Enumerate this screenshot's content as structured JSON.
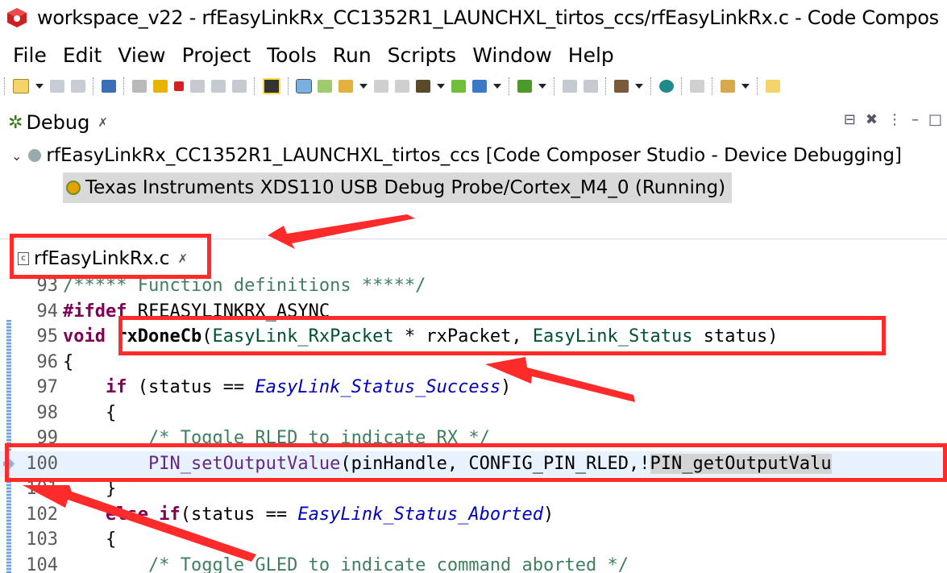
{
  "window": {
    "title": "workspace_v22 - rfEasyLinkRx_CC1352R1_LAUNCHXL_tirtos_ccs/rfEasyLinkRx.c - Code Compos"
  },
  "menu": [
    "File",
    "Edit",
    "View",
    "Project",
    "Tools",
    "Run",
    "Scripts",
    "Window",
    "Help"
  ],
  "debug_view": {
    "tab_label": "Debug",
    "close_glyph": "✗",
    "project_node": "rfEasyLinkRx_CC1352R1_LAUNCHXL_tirtos_ccs [Code Composer Studio - Device Debugging]",
    "probe_node": "Texas Instruments XDS110 USB Debug Probe/Cortex_M4_0 (Running)"
  },
  "editor": {
    "tab_label": "rfEasyLinkRx.c",
    "close_glyph": "✗",
    "lines": [
      {
        "n": "93",
        "parts": [
          [
            "cm",
            "/***** Function definitions *****/"
          ]
        ]
      },
      {
        "n": "94",
        "parts": [
          [
            "kw",
            "#ifdef"
          ],
          [
            "",
            " RFEASYLINKRX_ASYNC"
          ]
        ]
      },
      {
        "n": "95",
        "parts": [
          [
            "kw",
            "void"
          ],
          [
            "",
            " "
          ],
          [
            "fn",
            "rxDoneCb"
          ],
          [
            "",
            "("
          ],
          [
            "ty",
            "EasyLink_RxPacket"
          ],
          [
            "",
            " * rxPacket, "
          ],
          [
            "ty",
            "EasyLink_Status"
          ],
          [
            "",
            " status)"
          ]
        ]
      },
      {
        "n": "96",
        "parts": [
          [
            "",
            "{"
          ]
        ]
      },
      {
        "n": "97",
        "parts": [
          [
            "",
            "    "
          ],
          [
            "kw",
            "if"
          ],
          [
            "",
            " (status == "
          ],
          [
            "it",
            "EasyLink_Status_Success"
          ],
          [
            "",
            ")"
          ]
        ]
      },
      {
        "n": "98",
        "parts": [
          [
            "",
            "    {"
          ]
        ]
      },
      {
        "n": "99",
        "parts": [
          [
            "",
            "        "
          ],
          [
            "cm",
            "/* Toggle RLED to indicate RX */"
          ]
        ]
      },
      {
        "n": "100",
        "parts": [
          [
            "",
            "        "
          ],
          [
            "hlmacro",
            "PIN_setOutputValue"
          ],
          [
            "",
            "(pinHandle, CONFIG_PIN_RLED,!"
          ],
          [
            "occ",
            "PIN_getOutputValu"
          ]
        ]
      },
      {
        "n": "101",
        "parts": [
          [
            "",
            "    }"
          ]
        ]
      },
      {
        "n": "102",
        "parts": [
          [
            "",
            "    "
          ],
          [
            "kw",
            "else if"
          ],
          [
            "",
            "(status == "
          ],
          [
            "it",
            "EasyLink_Status_Aborted"
          ],
          [
            "",
            ")"
          ]
        ]
      },
      {
        "n": "103",
        "parts": [
          [
            "",
            "    {"
          ]
        ]
      },
      {
        "n": "104",
        "parts": [
          [
            "",
            "        "
          ],
          [
            "cm",
            "/* Toggle GLED to indicate command aborted */"
          ]
        ]
      }
    ]
  },
  "colors": {
    "annotation_red": "#ff2b2b",
    "current_line": "#e8f2fe",
    "keyword": "#7f0055",
    "comment": "#3f7f5f"
  }
}
